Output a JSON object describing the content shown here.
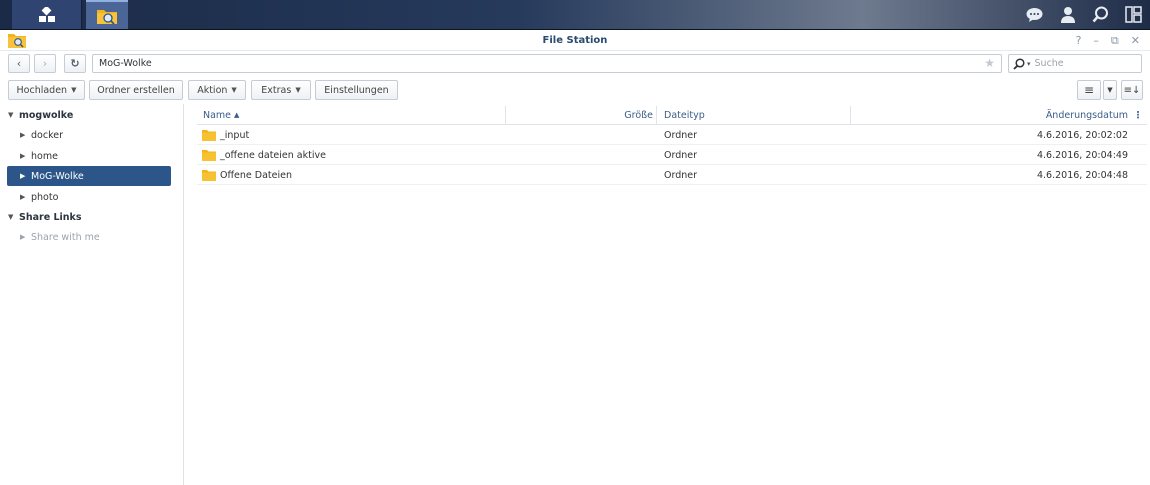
{
  "window": {
    "title": "File Station"
  },
  "taskbar": {
    "icons": [
      "main-menu-icon",
      "file-station-icon",
      "chat-icon",
      "user-icon",
      "search-icon",
      "widgets-icon"
    ]
  },
  "nav": {
    "path": "MoG-Wolke",
    "search_placeholder": "Suche"
  },
  "toolbar": {
    "upload": "Hochladen",
    "create_folder": "Ordner erstellen",
    "action": "Aktion",
    "extras": "Extras",
    "settings": "Einstellungen"
  },
  "sidebar": {
    "root": "mogwolke",
    "items": [
      "docker",
      "home",
      "MoG-Wolke",
      "photo"
    ],
    "share_links": "Share Links",
    "share_with_me": "Share with me"
  },
  "list": {
    "columns": {
      "name": "Name",
      "size": "Größe",
      "type": "Dateityp",
      "modified": "Änderungsdatum"
    },
    "rows": [
      {
        "name": "_input",
        "size": "",
        "type": "Ordner",
        "modified": "4.6.2016, 20:02:02"
      },
      {
        "name": "_offene dateien aktive",
        "size": "",
        "type": "Ordner",
        "modified": "4.6.2016, 20:04:49"
      },
      {
        "name": "Offene Dateien",
        "size": "",
        "type": "Ordner",
        "modified": "4.6.2016, 20:04:48"
      }
    ]
  },
  "colors": {
    "accent": "#2c5689",
    "folder": "#f2b418",
    "header_text": "#3b5d88"
  }
}
